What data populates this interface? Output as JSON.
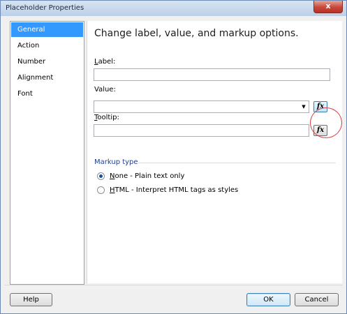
{
  "window": {
    "title": "Placeholder Properties",
    "close_glyph": "x"
  },
  "nav": {
    "items": [
      "General",
      "Action",
      "Number",
      "Alignment",
      "Font"
    ],
    "selected_index": 0
  },
  "general": {
    "heading": "Change label, value, and markup options.",
    "label": {
      "mnemonic": "L",
      "rest": "abel:",
      "value": ""
    },
    "value": {
      "caption": "Value:",
      "selected": ""
    },
    "tooltip": {
      "mnemonic": "T",
      "rest": "ooltip:",
      "value": ""
    },
    "fx_label": "fx",
    "markup": {
      "group_title": "Markup type",
      "options": [
        {
          "mnemonic": "N",
          "rest": "one - Plain text only",
          "checked": true
        },
        {
          "mnemonic": "H",
          "rest": "TML - Interpret HTML tags as styles",
          "checked": false
        }
      ]
    }
  },
  "buttons": {
    "help": "Help",
    "ok": "OK",
    "cancel": "Cancel"
  },
  "colors": {
    "selection": "#3399ff",
    "highlight_circle": "#d64242",
    "group_title": "#1f3e8a"
  }
}
